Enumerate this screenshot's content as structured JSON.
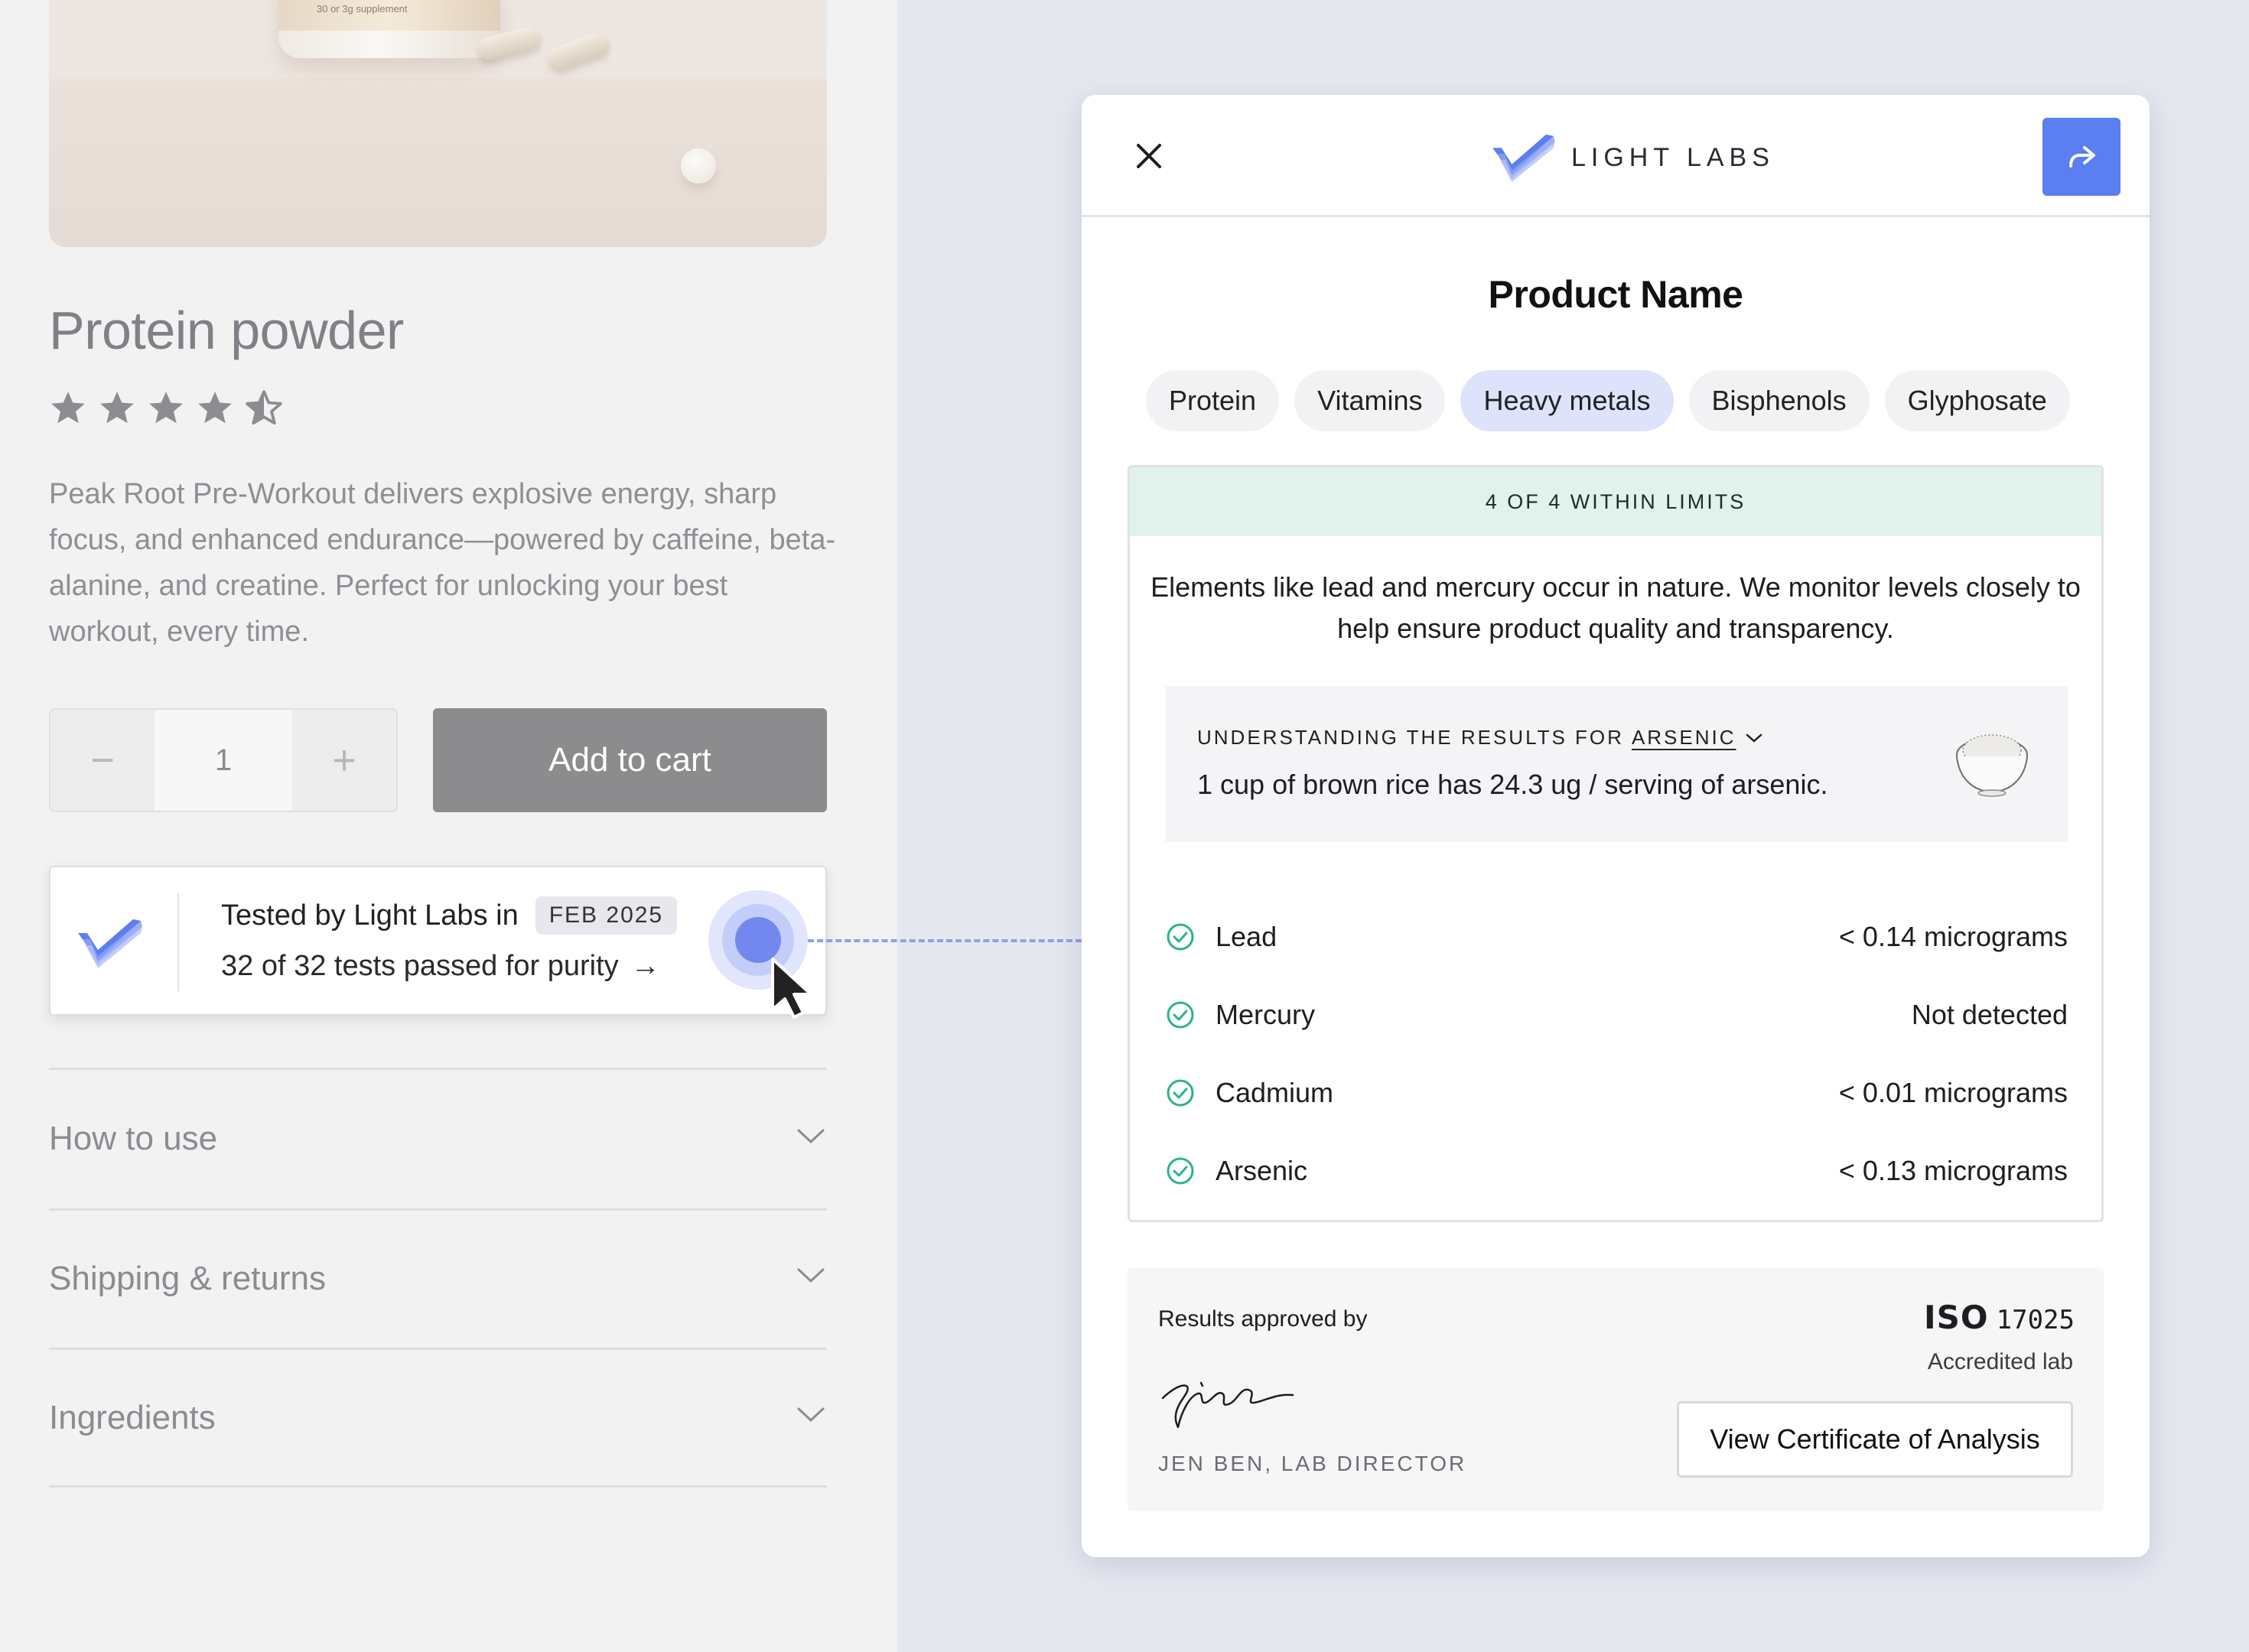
{
  "product": {
    "title": "Protein powder",
    "rating": 4.5,
    "rating_max": 5,
    "description": "Peak Root Pre-Workout  delivers explosive energy, sharp focus, and enhanced endurance—powered by caffeine, beta-alanine, and creatine. Perfect for unlocking your best workout, every time.",
    "jar_label": "30 or 3g supplement",
    "quantity": {
      "decrement_label": "−",
      "value": "1",
      "increment_label": "+"
    },
    "add_to_cart_label": "Add to cart"
  },
  "badge": {
    "line1": "Tested by Light Labs in",
    "date": "FEB 2025",
    "line2": "32 of 32 tests passed for purity",
    "arrow": "→"
  },
  "accordions": [
    {
      "label": "How to use"
    },
    {
      "label": "Shipping & returns"
    },
    {
      "label": "Ingredients"
    }
  ],
  "modal": {
    "brand": "LIGHT LABS",
    "product_name": "Product Name",
    "tabs": [
      {
        "label": "Protein",
        "active": false
      },
      {
        "label": "Vitamins",
        "active": false
      },
      {
        "label": "Heavy metals",
        "active": true
      },
      {
        "label": "Bisphenols",
        "active": false
      },
      {
        "label": "Glyphosate",
        "active": false
      }
    ],
    "summary": "4 OF 4 WITHIN LIMITS",
    "explanation_line1": "Elements like lead and mercury occur in nature. We monitor levels closely to",
    "explanation_line2": "help ensure product quality and transparency.",
    "understanding": {
      "heading_prefix": "UNDERSTANDING THE RESULTS FOR",
      "element": "ARSENIC",
      "body": "1 cup of brown rice has 24.3 ug / serving of arsenic."
    },
    "metals": [
      {
        "name": "Lead",
        "value": "< 0.14 micrograms"
      },
      {
        "name": "Mercury",
        "value": "Not detected"
      },
      {
        "name": "Cadmium",
        "value": "< 0.01 micrograms"
      },
      {
        "name": "Arsenic",
        "value": "< 0.13 micrograms"
      }
    ],
    "approval": {
      "label": "Results approved by",
      "director": "JEN BEN, LAB DIRECTOR",
      "iso_mark": "ISO",
      "iso_number": "17025",
      "accredited": "Accredited lab",
      "coa_button": "View Certificate of Analysis"
    }
  },
  "colors": {
    "accent_blue": "#5b7ef0",
    "active_tab": "#dde3fb",
    "within_limits_banner": "#e1f2ec",
    "check_green": "#2bb38b",
    "add_to_cart_bg": "#8c8c8f"
  },
  "icons": {
    "close": "close-icon",
    "share": "share-icon",
    "check": "check-circle-icon",
    "chevron": "chevron-down-icon",
    "star": "star-icon",
    "cursor": "cursor-pointer-icon",
    "bowl": "rice-bowl-icon"
  }
}
